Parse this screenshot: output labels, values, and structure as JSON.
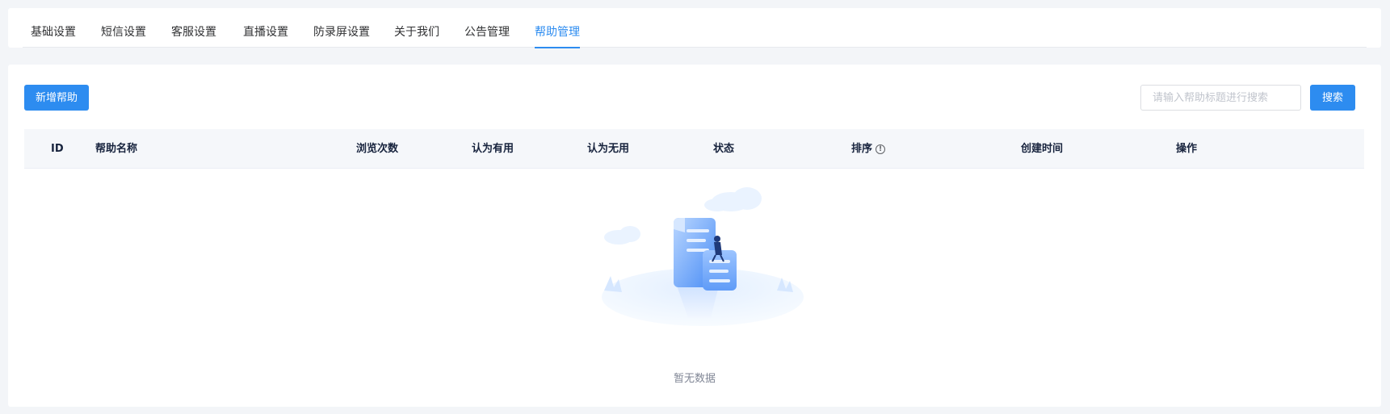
{
  "tabs": [
    {
      "label": "基础设置",
      "active": false
    },
    {
      "label": "短信设置",
      "active": false
    },
    {
      "label": "客服设置",
      "active": false
    },
    {
      "label": "直播设置",
      "active": false
    },
    {
      "label": "防录屏设置",
      "active": false
    },
    {
      "label": "关于我们",
      "active": false
    },
    {
      "label": "公告管理",
      "active": false
    },
    {
      "label": "帮助管理",
      "active": true
    }
  ],
  "toolbar": {
    "add_label": "新增帮助",
    "search_placeholder": "请输入帮助标题进行搜索",
    "search_value": "",
    "search_label": "搜索"
  },
  "table": {
    "columns": [
      "ID",
      "帮助名称",
      "浏览次数",
      "认为有用",
      "认为无用",
      "状态",
      "排序",
      "创建时间",
      "操作"
    ],
    "sort_info_icon": "info-circle-icon",
    "rows": [],
    "empty_text": "暂无数据"
  },
  "colors": {
    "accent": "#2d8cf0",
    "header_bg": "#f5f7fa",
    "page_bg": "#f3f5f8"
  }
}
